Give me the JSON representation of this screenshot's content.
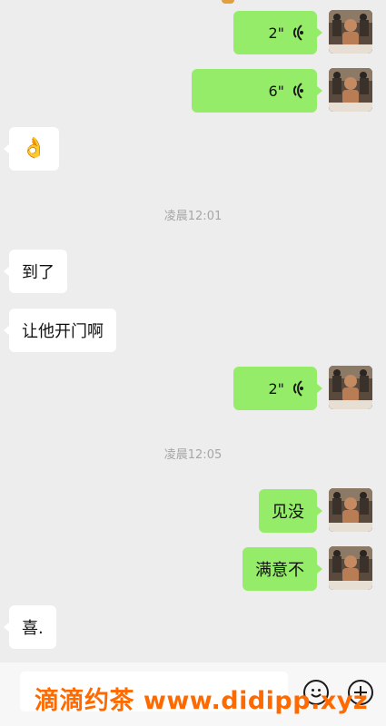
{
  "messages": [
    {
      "side": "out",
      "type": "voice",
      "duration": "2\""
    },
    {
      "side": "out",
      "type": "voice",
      "duration": "6\""
    },
    {
      "side": "in",
      "type": "emoji",
      "content": "👌"
    },
    {
      "type": "timestamp",
      "text": "凌晨12:01"
    },
    {
      "side": "in",
      "type": "text",
      "content": "到了"
    },
    {
      "side": "in",
      "type": "text",
      "content": "让他开门啊"
    },
    {
      "side": "out",
      "type": "voice",
      "duration": "2\""
    },
    {
      "type": "timestamp",
      "text": "凌晨12:05"
    },
    {
      "side": "out",
      "type": "text",
      "content": "见没"
    },
    {
      "side": "out",
      "type": "text",
      "content": "满意不"
    },
    {
      "side": "in",
      "type": "text",
      "content": "喜."
    }
  ],
  "watermark": "滴滴约茶 www.didipp.xyz",
  "icons": {
    "voice": "voice-wave-icon",
    "emoji_button": "emoji-face-icon",
    "more_button": "plus-circle-icon"
  },
  "colors": {
    "chat_bg": "#ededed",
    "outgoing_bubble": "#95ec69",
    "incoming_bubble": "#ffffff",
    "watermark": "#ff6a00"
  }
}
